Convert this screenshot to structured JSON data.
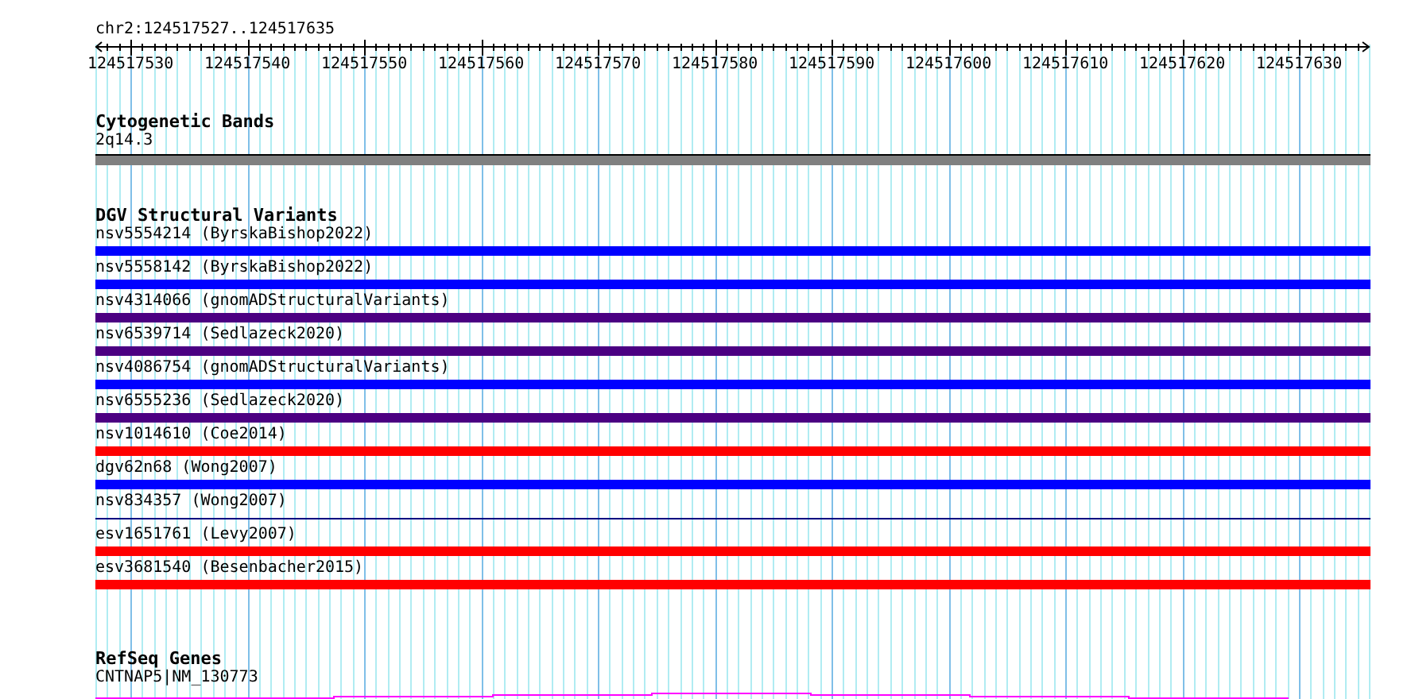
{
  "ruler": {
    "location": "chr2:124517527..124517635",
    "ticks": [
      "124517530",
      "124517540",
      "124517550",
      "124517560",
      "124517570",
      "124517580",
      "124517590",
      "124517600",
      "124517610",
      "124517620",
      "124517630"
    ]
  },
  "cytogenetic_bands": {
    "title": "Cytogenetic Bands",
    "band": "2q14.3"
  },
  "dgv_structural_variants": {
    "title": "DGV Structural Variants",
    "variants": [
      {
        "label": "nsv5554214 (ByrskaBishop2022)",
        "kind": "bar",
        "color": "#0000ff"
      },
      {
        "label": "nsv5558142 (ByrskaBishop2022)",
        "kind": "bar",
        "color": "#0000ff"
      },
      {
        "label": "nsv4314066 (gnomADStructuralVariants)",
        "kind": "bar",
        "color": "#4b0082"
      },
      {
        "label": "nsv6539714 (Sedlazeck2020)",
        "kind": "bar",
        "color": "#4b0082"
      },
      {
        "label": "nsv4086754 (gnomADStructuralVariants)",
        "kind": "bar",
        "color": "#0000ff"
      },
      {
        "label": "nsv6555236 (Sedlazeck2020)",
        "kind": "bar",
        "color": "#4b0082"
      },
      {
        "label": "nsv1014610 (Coe2014)",
        "kind": "bar",
        "color": "#ff0000"
      },
      {
        "label": "dgv62n68 (Wong2007)",
        "kind": "bar",
        "color": "#0000ff"
      },
      {
        "label": "nsv834357 (Wong2007)",
        "kind": "line",
        "color": "#000080"
      },
      {
        "label": "esv1651761 (Levy2007)",
        "kind": "bar",
        "color": "#ff0000"
      },
      {
        "label": "esv3681540 (Besenbacher2015)",
        "kind": "bar",
        "color": "#ff0000"
      }
    ]
  },
  "refseq_genes": {
    "title": "RefSeq Genes",
    "gene": "CNTNAP5|NM_130773"
  }
}
